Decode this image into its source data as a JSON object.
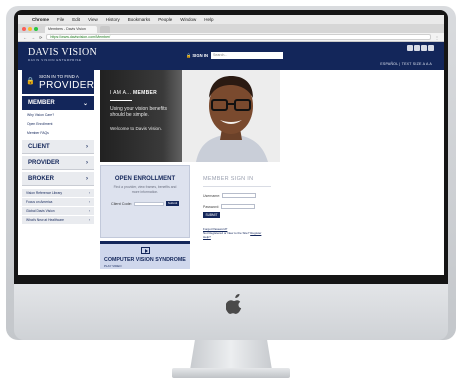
{
  "menubar": {
    "items": [
      "Chrome",
      "File",
      "Edit",
      "View",
      "History",
      "Bookmarks",
      "People",
      "Window",
      "Help"
    ]
  },
  "browser": {
    "tab_title": "Members - Davis Vision",
    "url": "https://www.davisvision.com/Member/"
  },
  "header": {
    "logo": "DAVIS VISION",
    "tagline": "DAVIS VISION ENTERPRISE",
    "sign_in": "SIGN IN",
    "search_placeholder": "Search...",
    "utility": "ESPAÑOL  |  TEXT SIZE  A  A  A"
  },
  "sidebar": {
    "find_provider_line1": "SIGN IN TO FIND A",
    "find_provider_line2": "PROVIDER",
    "member_label": "MEMBER",
    "member_links": [
      "Why Vision Care?",
      "Open Enrollment",
      "Member FAQs"
    ],
    "client_label": "CLIENT",
    "provider_label": "PROVIDER",
    "broker_label": "BROKER",
    "resources": [
      "Vision Reference Library",
      "Focus on America",
      "Global Davis Vision",
      "What's New at Healthcare"
    ]
  },
  "hero": {
    "prefix": "I AM A...",
    "role": "MEMBER",
    "message": "Using your vision benefits should be simple.",
    "welcome": "Welcome to Davis Vision."
  },
  "enrollment": {
    "title": "OPEN ENROLLMENT",
    "description": "Find a provider, view frames, benefits and more information.",
    "client_code_label": "Client Code:",
    "button": "Submit"
  },
  "cvs": {
    "title": "COMPUTER VISION SYNDROME",
    "subtitle": "PLAY VIDEO"
  },
  "member_signin": {
    "title": "MEMBER SIGN IN",
    "username_label": "Username:",
    "password_label": "Password:",
    "submit": "SUBMIT",
    "forgot": "Forgot Password?",
    "register_prefix": "Not Registered or New to the Site?",
    "register_link": "Register",
    "help": "Help?"
  },
  "colors": {
    "brand_navy": "#13265a",
    "panel_gray": "#e9ebef"
  }
}
